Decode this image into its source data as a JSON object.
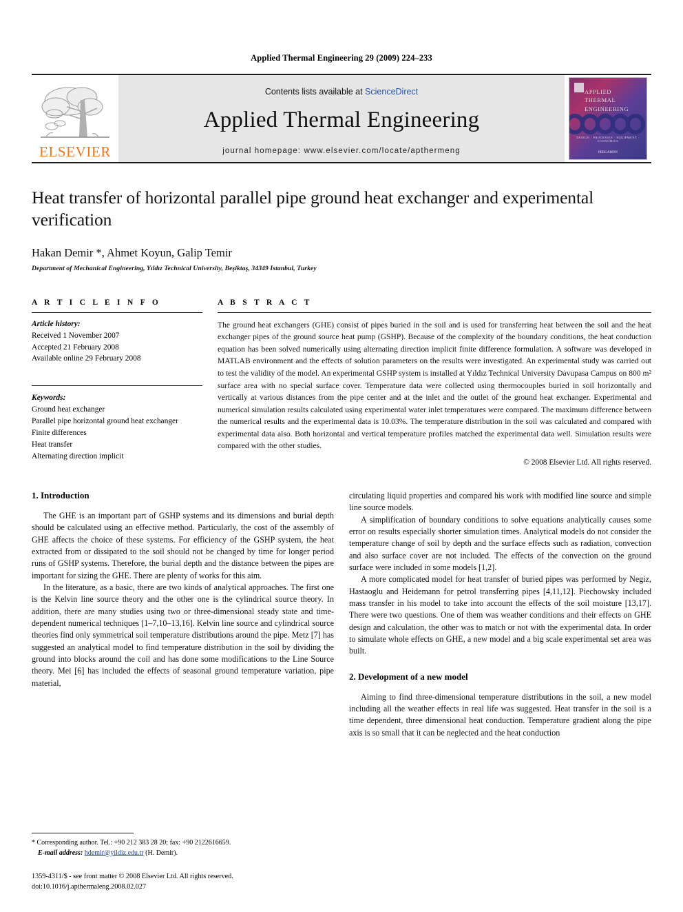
{
  "running_head": "Applied Thermal Engineering 29 (2009) 224–233",
  "masthead": {
    "publisher_name": "ELSEVIER",
    "contents_prefix": "Contents lists available at ",
    "contents_link": "ScienceDirect",
    "journal_title": "Applied Thermal Engineering",
    "homepage": "journal homepage: www.elsevier.com/locate/apthermeng",
    "cover": {
      "line1": "APPLIED",
      "line2": "THERMAL",
      "line3": "ENGINEERING",
      "subtitle": "DESIGN  ·  PROCESSES  ·  EQUIPMENT  ·  ECONOMICS",
      "publisher": "PERGAMON"
    }
  },
  "article": {
    "title": "Heat transfer of horizontal parallel pipe ground heat exchanger and experimental verification",
    "authors": "Hakan Demir *, Ahmet Koyun, Galip Temir",
    "affiliation": "Department of Mechanical Engineering, Yıldız Technical University, Beşiktaş, 34349 Istanbul, Turkey"
  },
  "article_info": {
    "heading": "A R T I C L E   I N F O",
    "history_label": "Article history:",
    "history": [
      "Received 1 November 2007",
      "Accepted 21 February 2008",
      "Available online 29 February 2008"
    ],
    "keywords_label": "Keywords:",
    "keywords": [
      "Ground heat exchanger",
      "Parallel pipe horizontal ground heat exchanger",
      "Finite differences",
      "Heat transfer",
      "Alternating direction implicit"
    ]
  },
  "abstract": {
    "heading": "A B S T R A C T",
    "text": "The ground heat exchangers (GHE) consist of pipes buried in the soil and is used for transferring heat between the soil and the heat exchanger pipes of the ground source heat pump (GSHP). Because of the complexity of the boundary conditions, the heat conduction equation has been solved numerically using alternating direction implicit finite difference formulation. A software was developed in MATLAB environment and the effects of solution parameters on the results were investigated. An experimental study was carried out to test the validity of the model. An experimental GSHP system is installed at Yıldız Technical University Davupasa Campus on 800 m² surface area with no special surface cover. Temperature data were collected using thermocouples buried in soil horizontally and vertically at various distances from the pipe center and at the inlet and the outlet of the ground heat exchanger. Experimental and numerical simulation results calculated using experimental water inlet temperatures were compared. The maximum difference between the numerical results and the experimental data is 10.03%. The temperature distribution in the soil was calculated and compared with experimental data also. Both horizontal and vertical temperature profiles matched the experimental data well. Simulation results were compared with the other studies.",
    "copyright": "© 2008 Elsevier Ltd. All rights reserved."
  },
  "body": {
    "section1_title": "1. Introduction",
    "left_p1": "The GHE is an important part of GSHP systems and its dimensions and burial depth should be calculated using an effective method. Particularly, the cost of the assembly of GHE affects the choice of these systems. For efficiency of the GSHP system, the heat extracted from or dissipated to the soil should not be changed by time for longer period runs of GSHP systems. Therefore, the burial depth and the distance between the pipes are important for sizing the GHE. There are plenty of works for this aim.",
    "left_p2": "In the literature, as a basic, there are two kinds of analytical approaches. The first one is the Kelvin line source theory and the other one is the cylindrical source theory. In addition, there are many studies using two or three-dimensional steady state and time-dependent numerical techniques [1–7,10–13,16]. Kelvin line source and cylindrical source theories find only symmetrical soil temperature distributions around the pipe. Metz [7] has suggested an analytical model to find temperature distribution in the soil by dividing the ground into blocks around the coil and has done some modifications to the Line Source theory. Mei [6] has included the effects of seasonal ground temperature variation, pipe material,",
    "right_p1": "circulating liquid properties and compared his work with modified line source and simple line source models.",
    "right_p2": "A simplification of boundary conditions to solve equations analytically causes some error on results especially shorter simulation times. Analytical models do not consider the temperature change of soil by depth and the surface effects such as radiation, convection and also surface cover are not included. The effects of the convection on the ground surface were included in some models [1,2].",
    "right_p3": "A more complicated model for heat transfer of buried pipes was performed by Negiz, Hastaoglu and Heidemann for petrol transferring pipes [4,11,12]. Piechowsky included mass transfer in his model to take into account the effects of the soil moisture [13,17]. There were two questions. One of them was weather conditions and their effects on GHE design and calculation, the other was to match or not with the experimental data. In order to simulate whole effects on GHE, a new model and a big scale experimental set area was built.",
    "section2_title": "2. Development of a new model",
    "right_p4": "Aiming to find three-dimensional temperature distributions in the soil, a new model including all the weather effects in real life was suggested. Heat transfer in the soil is a time dependent, three dimensional heat conduction. Temperature gradient along the pipe axis is so small that it can be neglected and the heat conduction"
  },
  "footer": {
    "corresponding": "* Corresponding author. Tel.: +90 212 383 28 20; fax: +90 2122616659.",
    "email_label": "E-mail address:",
    "email": "hdemir@yildiz.edu.tr",
    "email_suffix": " (H. Demir).",
    "issn_line": "1359-4311/$ - see front matter © 2008 Elsevier Ltd. All rights reserved.",
    "doi_line": "doi:10.1016/j.apthermaleng.2008.02.027"
  },
  "colors": {
    "link": "#1a3c8c",
    "sciencedirect": "#2a53a5",
    "elsevier_orange": "#E87722",
    "masthead_bg": "#e6e6e6"
  }
}
